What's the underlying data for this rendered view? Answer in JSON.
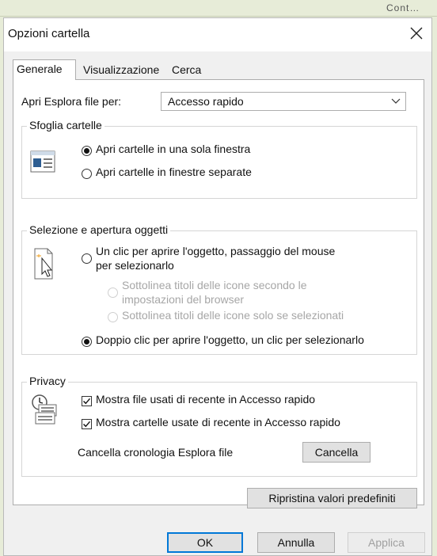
{
  "background": {
    "peek_text": "Cont…"
  },
  "window": {
    "title": "Opzioni cartella"
  },
  "tabs": [
    {
      "label": "Generale",
      "active": true
    },
    {
      "label": "Visualizzazione",
      "active": false
    },
    {
      "label": "Cerca",
      "active": false
    }
  ],
  "general": {
    "open_explorer_label": "Apri Esplora file per:",
    "open_explorer_value": "Accesso rapido",
    "browse": {
      "title": "Sfoglia cartelle",
      "option_same_window": "Apri cartelle in una sola finestra",
      "option_separate_windows": "Apri cartelle in finestre separate",
      "selected": "same_window"
    },
    "click": {
      "title": "Selezione e apertura oggetti",
      "single_click_line1": "Un clic per aprire l'oggetto, passaggio del mouse",
      "single_click_line2": "per selezionarlo",
      "underline_browser_line1": "Sottolinea titoli delle icone secondo le",
      "underline_browser_line2": "impostazioni del browser",
      "underline_hover": "Sottolinea titoli delle icone solo se selezionati",
      "double_click": "Doppio clic per aprire l'oggetto, un clic per selezionarlo",
      "selected": "double_click"
    },
    "privacy": {
      "title": "Privacy",
      "show_recent_files": "Mostra file usati di recente in Accesso rapido",
      "show_recent_folders": "Mostra cartelle usate di recente in Accesso rapido",
      "clear_history_label": "Cancella cronologia Esplora file",
      "clear_button": "Cancella",
      "show_recent_files_checked": true,
      "show_recent_folders_checked": true
    },
    "restore_defaults_button": "Ripristina valori predefiniti"
  },
  "footer": {
    "ok": "OK",
    "cancel": "Annulla",
    "apply": "Applica"
  },
  "colors": {
    "accent": "#0078d7",
    "dialog_bg": "#f0f0f0",
    "backdrop": "#e7ecd8"
  }
}
